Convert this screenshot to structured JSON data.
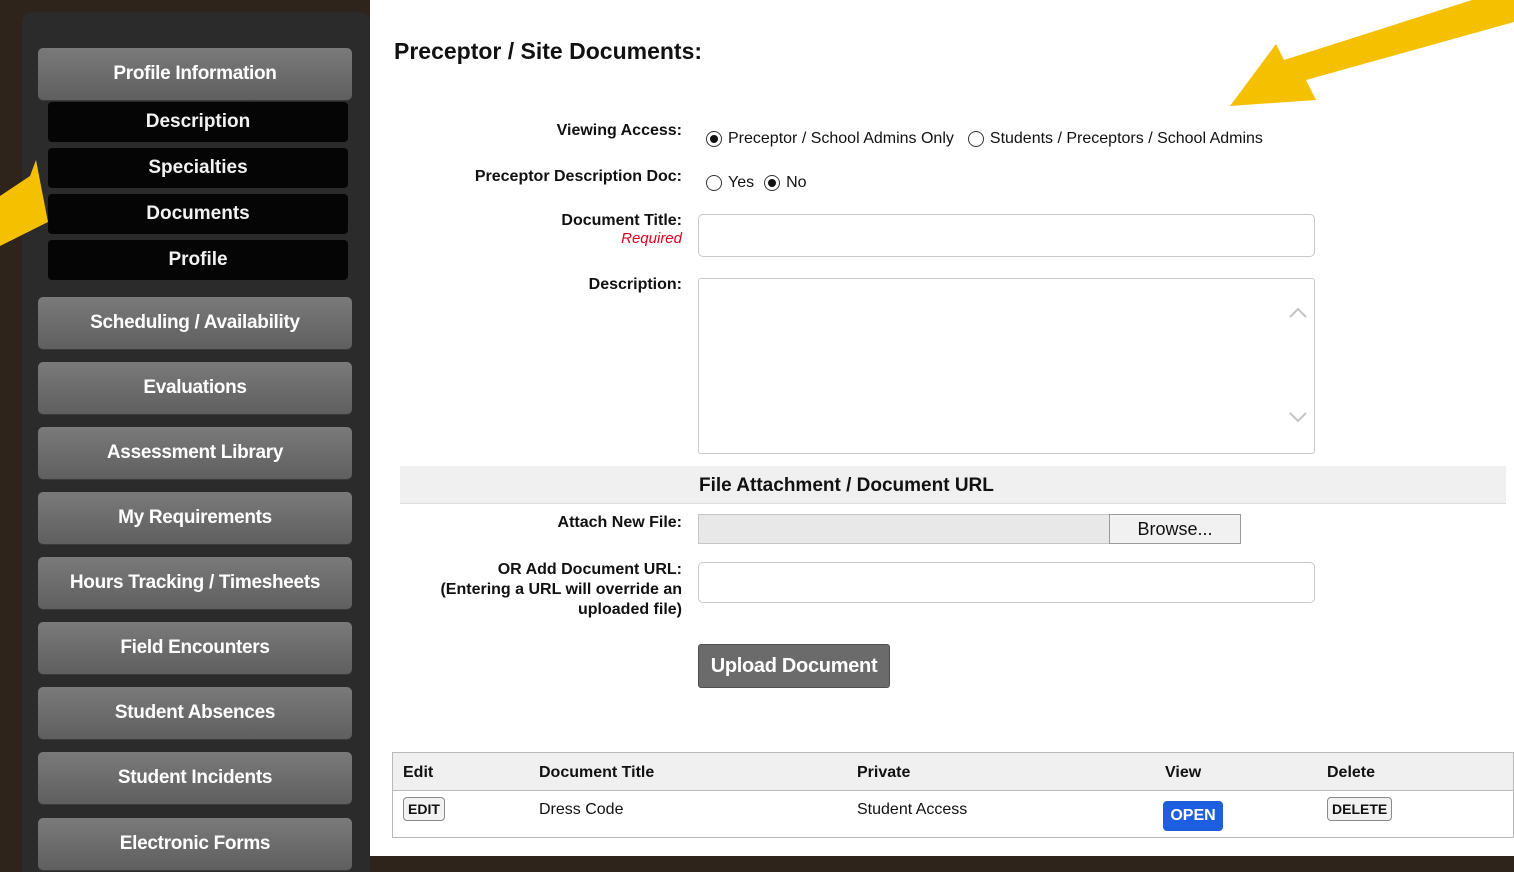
{
  "sidebar": {
    "items": [
      {
        "label": "Profile Information"
      },
      {
        "label": "Description"
      },
      {
        "label": "Specialties"
      },
      {
        "label": "Documents"
      },
      {
        "label": "Profile"
      },
      {
        "label": "Scheduling / Availability"
      },
      {
        "label": "Evaluations"
      },
      {
        "label": "Assessment Library"
      },
      {
        "label": "My Requirements"
      },
      {
        "label": "Hours Tracking / Timesheets"
      },
      {
        "label": "Field Encounters"
      },
      {
        "label": "Student Absences"
      },
      {
        "label": "Student Incidents"
      },
      {
        "label": "Electronic Forms"
      }
    ]
  },
  "page": {
    "title": "Preceptor / Site Documents:"
  },
  "form": {
    "viewing_access_label": "Viewing Access:",
    "viewing_access_options": [
      "Preceptor / School Admins Only",
      "Students / Preceptors / School Admins"
    ],
    "viewing_access_selected": "Preceptor / School Admins Only",
    "desc_doc_label": "Preceptor Description Doc:",
    "desc_doc_options": [
      "Yes",
      "No"
    ],
    "desc_doc_selected": "No",
    "title_label": "Document Title:",
    "title_required": "Required",
    "title_value": "",
    "description_label": "Description:",
    "description_value": "",
    "section_header": "File Attachment / Document URL",
    "attach_label": "Attach New File:",
    "browse_label": "Browse...",
    "url_label_line1": "OR Add Document URL:",
    "url_label_line2": "(Entering a URL will override an",
    "url_label_line3": "uploaded file)",
    "url_value": "",
    "upload_label": "Upload Document"
  },
  "table": {
    "headers": [
      "Edit",
      "Document Title",
      "Private",
      "View",
      "Delete"
    ],
    "rows": [
      {
        "edit": "EDIT",
        "title": "Dress Code",
        "private": "Student Access",
        "view": "OPEN",
        "delete": "DELETE"
      }
    ]
  },
  "colors": {
    "arrow": "#f5c000",
    "open_button": "#1e5fe0",
    "required": "#e0001b"
  }
}
